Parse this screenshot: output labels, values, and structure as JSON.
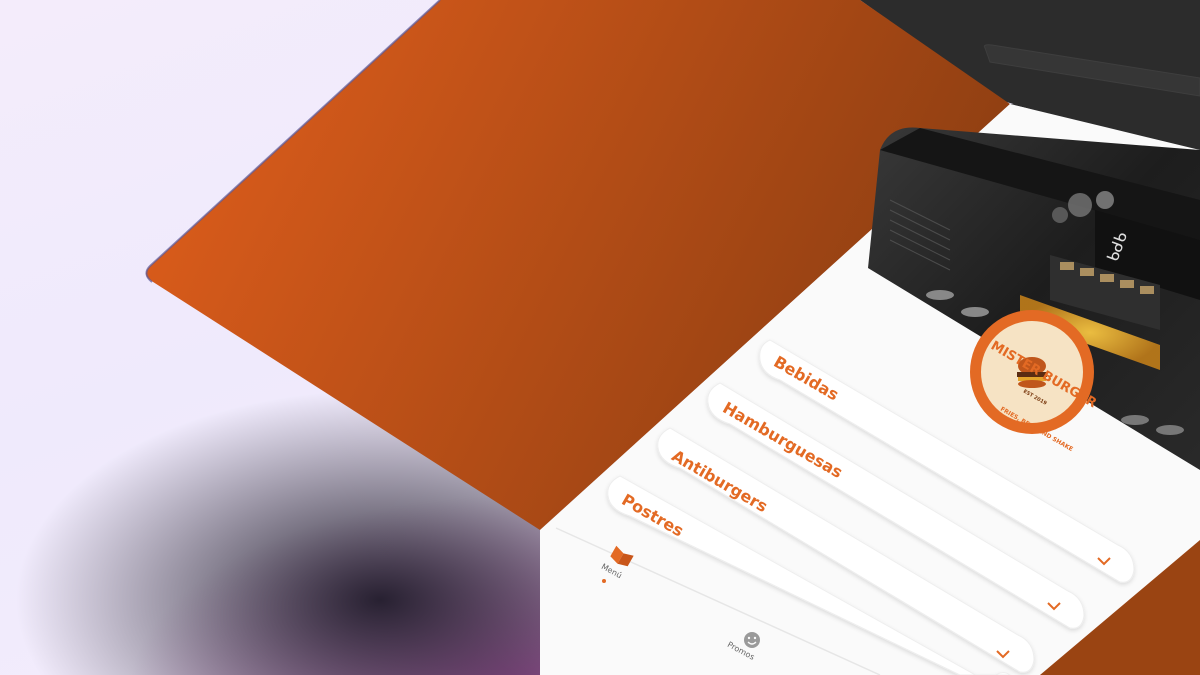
{
  "app": {
    "brand": "MISTER BURGER",
    "brand_tagline": "FRIES, BEER AND SHAKE",
    "brand_est": "EST 2019"
  },
  "menu": {
    "categories": [
      {
        "label": "Bebidas"
      },
      {
        "label": "Hamburguesas"
      },
      {
        "label": "Antiburgers"
      },
      {
        "label": "Postres"
      }
    ]
  },
  "bottom_nav": {
    "items": [
      {
        "label": "Menú",
        "icon": "book-icon",
        "active": true
      },
      {
        "label": "Promos",
        "icon": "smile-icon",
        "active": false
      }
    ]
  },
  "colors": {
    "accent": "#e36a24",
    "hero_start": "#e35f1c",
    "hero_end": "#8f3f12",
    "bezel": "#2b2b2b",
    "surface": "#fafafa"
  }
}
